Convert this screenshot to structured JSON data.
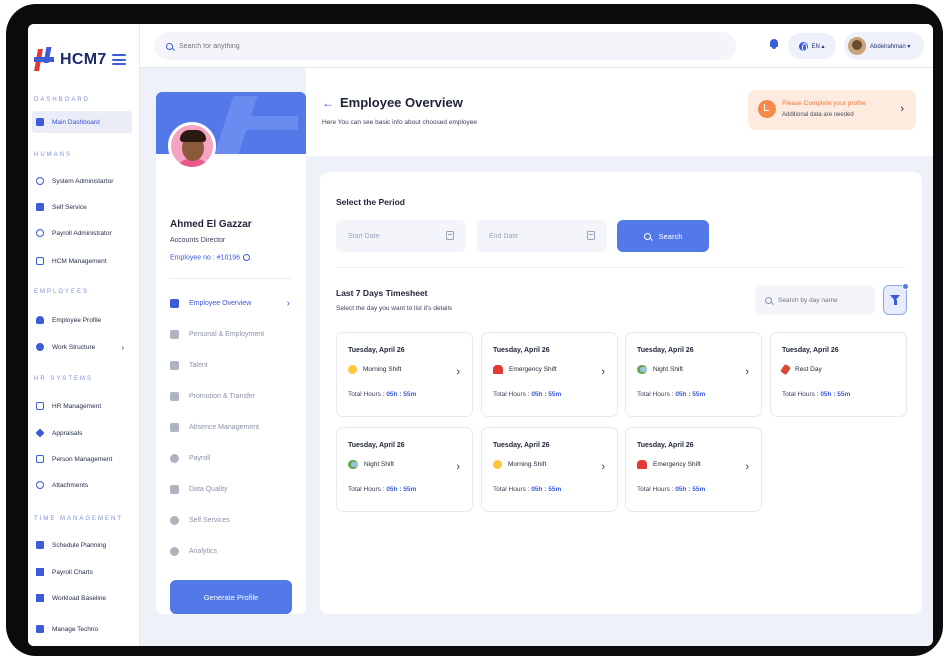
{
  "app": {
    "name": "HCM7"
  },
  "topbar": {
    "search_placeholder": "Search for anything",
    "lang": "EN ▴",
    "user_name": "Abdelrahman ▾"
  },
  "sidebar": {
    "sections": [
      {
        "label": "DASHBOARD",
        "items": [
          {
            "label": "Main Dashboard",
            "icon": "grid-icon"
          }
        ]
      },
      {
        "label": "HUMANS",
        "items": [
          {
            "label": "System Administartor",
            "icon": "user-icon"
          },
          {
            "label": "Self Service",
            "icon": "list-icon"
          },
          {
            "label": "Payroll Administrator",
            "icon": "check-circle-icon"
          },
          {
            "label": "HCM Management",
            "icon": "document-icon"
          }
        ]
      },
      {
        "label": "EMPLOYEES",
        "items": [
          {
            "label": "Employee Profile",
            "icon": "person-icon"
          },
          {
            "label": "Work Structure",
            "icon": "people-icon"
          }
        ]
      },
      {
        "label": "HR SYSTEMS",
        "items": [
          {
            "label": "HR Management",
            "icon": "checklist-icon"
          },
          {
            "label": "Appraisals",
            "icon": "layers-icon"
          },
          {
            "label": "Person Management",
            "icon": "id-card-icon"
          },
          {
            "label": "Attachments",
            "icon": "paperclip-icon"
          }
        ]
      },
      {
        "label": "TIME MANAGEMENT",
        "items": [
          {
            "label": "Schedule Planning",
            "icon": "file-icon"
          },
          {
            "label": "Payroll Charts",
            "icon": "bar-chart-icon"
          },
          {
            "label": "Workload Baseline",
            "icon": "baseline-icon"
          },
          {
            "label": "Manage Techno",
            "icon": "tech-icon"
          }
        ]
      }
    ]
  },
  "profile": {
    "name": "Ahmed El Gazzar",
    "role": "Accounts Director",
    "employee_no": "Employee no : #10196",
    "menu": [
      {
        "label": "Employee Overview",
        "active": true
      },
      {
        "label": "Personal & Employment"
      },
      {
        "label": "Talent"
      },
      {
        "label": "Promotion & Transfer"
      },
      {
        "label": "Absence Management"
      },
      {
        "label": "Payroll"
      },
      {
        "label": "Data Quality"
      },
      {
        "label": "Self Services"
      },
      {
        "label": "Analytics"
      }
    ],
    "generate_label": "Generate Profile"
  },
  "header": {
    "title": "Employee Overview",
    "subtitle": "Here You can see basic info about choosed employee",
    "alert_title": "Please Complete your profile",
    "alert_sub": "Additional data are needed"
  },
  "period": {
    "title": "Select the Period",
    "start_placeholder": "Start Date",
    "end_placeholder": "End Date",
    "search_label": "Search"
  },
  "timesheet": {
    "title": "Last 7 Days Timesheet",
    "subtitle": "Select the day you want to list it's details",
    "search_placeholder": "Search by day name",
    "hours_label": "Total Hours :",
    "days": [
      {
        "date": "Tuesday, April 26",
        "shift": "Morning Shift",
        "icon": "sun-icon",
        "hours": "05h : 55m"
      },
      {
        "date": "Tuesday, April 26",
        "shift": "Emergency Shift",
        "icon": "siren-icon",
        "hours": "05h : 55m"
      },
      {
        "date": "Tuesday, April 26",
        "shift": "Night Shift",
        "icon": "cloud-icon",
        "hours": "05h : 55m"
      },
      {
        "date": "Tuesday, April 26",
        "shift": "Rest Day",
        "icon": "party-icon",
        "hours": "05h : 55m"
      },
      {
        "date": "Tuesday, April 26",
        "shift": "Night Shift",
        "icon": "cloud-icon",
        "hours": "05h : 55m"
      },
      {
        "date": "Tuesday, April 26",
        "shift": "Morning Shift",
        "icon": "sun-icon",
        "hours": "05h : 55m"
      },
      {
        "date": "Tuesday, April 26",
        "shift": "Emergency Shift",
        "icon": "siren-icon",
        "hours": "05h : 55m"
      }
    ]
  }
}
